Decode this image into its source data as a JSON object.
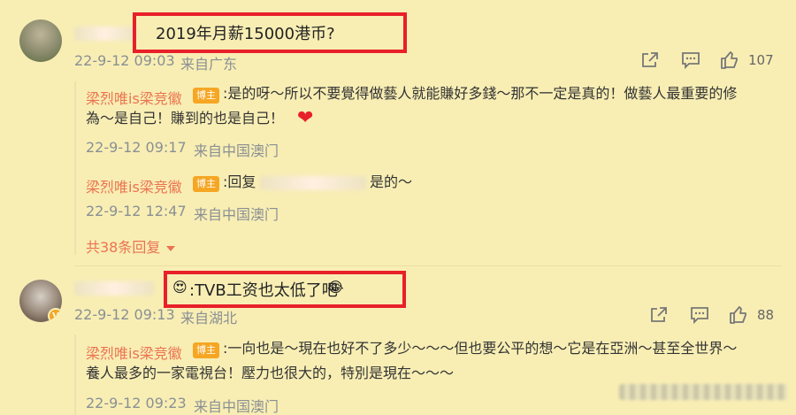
{
  "comment1": {
    "text": "2019年月薪15000港币?",
    "time": "22-9-12 09:03",
    "source": "来自广东",
    "likes": "107"
  },
  "reply1": {
    "user": "梁烈唯is梁竞徽",
    "badge": "博主",
    "text_line1": ":是的呀～所以不要覺得做藝人就能賺好多錢～那不一定是真的！做藝人最重要的修",
    "text_line2": "為～是自己！賺到的也是自己！",
    "heart": "❤",
    "time": "22-9-12 09:17",
    "source": "来自中国澳门"
  },
  "reply2": {
    "user": "梁烈唯is梁竞徽",
    "badge": "博主",
    "text_prefix": ":回复",
    "text_suffix": "是的～",
    "time": "22-9-12 12:47",
    "source": "来自中国澳门"
  },
  "more_replies": "共38条回复",
  "comment2": {
    "emoji_start": "😍",
    "text": ":TVB工资也太低了吧",
    "emoji_end": "😂",
    "time": "22-9-12 09:13",
    "source": "来自湖北",
    "likes": "88"
  },
  "reply3": {
    "user": "梁烈唯is梁竞徽",
    "badge": "博主",
    "text_line1": ":一向也是～現在也好不了多少～～～但也要公平的想～它是在亞洲～甚至全世界～",
    "text_line2": "養人最多的一家電視台！壓力也很大的，特別是現在～～～",
    "time": "22-9-12 09:23",
    "source": "来自中国澳门"
  }
}
